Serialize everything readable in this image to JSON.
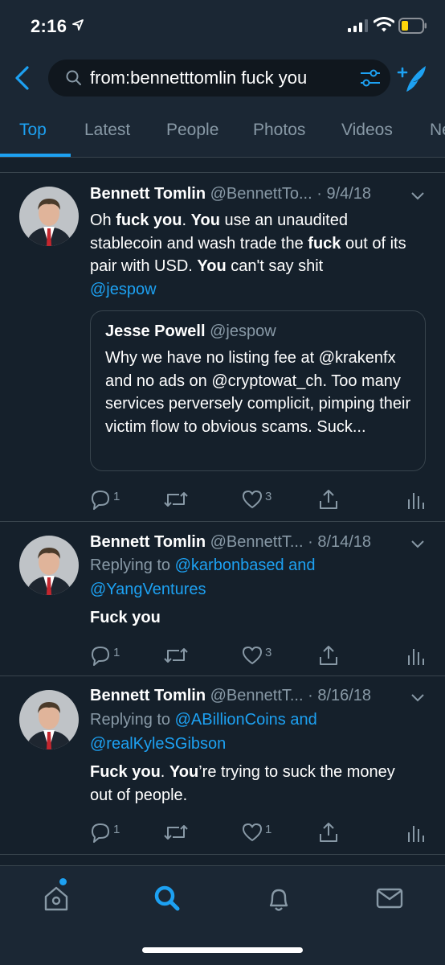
{
  "status_bar": {
    "time": "2:16"
  },
  "search": {
    "query": "from:bennetttomlin fuck you"
  },
  "tabs": [
    {
      "label": "Top",
      "active": true
    },
    {
      "label": "Latest",
      "active": false
    },
    {
      "label": "People",
      "active": false
    },
    {
      "label": "Photos",
      "active": false
    },
    {
      "label": "Videos",
      "active": false
    },
    {
      "label": "News",
      "active": false
    }
  ],
  "tweets": [
    {
      "name": "Bennett Tomlin",
      "handle": "@BennettTo...",
      "date": "· 9/4/18",
      "text_parts": [
        "Oh ",
        "fuck you",
        ". ",
        "You",
        " use an unaudited stablecoin and wash trade the ",
        "fuck",
        " out of its pair with USD. ",
        "You",
        " can't say shit",
        "@jespow"
      ],
      "quote": {
        "name": "Jesse Powell",
        "handle": "@jespow",
        "text": "Why we have no listing fee at @krakenfx and no ads on @cryptowat_ch. Too many services perversely complicit, pimping their victim flow to obvious scams. Suck..."
      },
      "replies": "1",
      "retweets": "",
      "likes": "3"
    },
    {
      "name": "Bennett Tomlin",
      "handle": "@BennettT...",
      "date": "· 8/14/18",
      "replying_prefix": "Replying to ",
      "replying_to": "@karbonbased and",
      "replying_to_2": "@YangVentures",
      "text": "Fuck you",
      "replies": "1",
      "retweets": "",
      "likes": "3"
    },
    {
      "name": "Bennett Tomlin",
      "handle": "@BennettT...",
      "date": "· 8/16/18",
      "replying_prefix": "Replying to ",
      "replying_to": "@ABillionCoins and",
      "replying_to_2": "@realKyleSGibson",
      "text_parts": [
        "Fuck you",
        ". ",
        "You",
        "’re trying to suck the money out of people."
      ],
      "replies": "1",
      "retweets": "",
      "likes": "1"
    }
  ],
  "nav": {
    "home_has_notification": true,
    "active": "search"
  },
  "colors": {
    "background": "#15202b",
    "bar": "#1b2734",
    "accent": "#1da1f2",
    "muted": "#8899a6",
    "divider": "#38444d"
  }
}
